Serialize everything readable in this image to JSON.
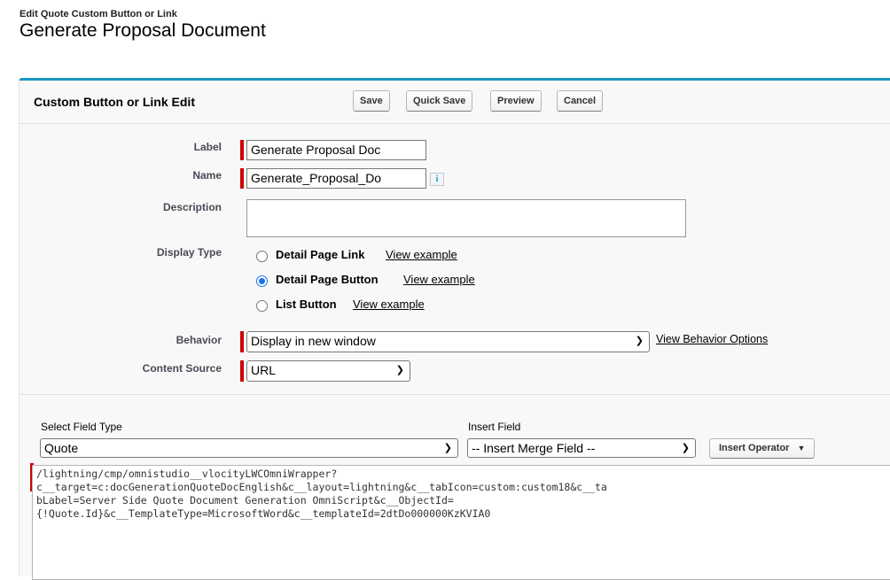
{
  "page": {
    "subtitle": "Edit Quote Custom Button or Link",
    "title": "Generate Proposal Document"
  },
  "panel": {
    "title": "Custom Button or Link Edit",
    "buttons": {
      "save": "Save",
      "quick_save": "Quick Save",
      "preview": "Preview",
      "cancel": "Cancel"
    }
  },
  "form": {
    "label": {
      "label": "Label",
      "value": "Generate Proposal Doc"
    },
    "name": {
      "label": "Name",
      "value": "Generate_Proposal_Do",
      "info_icon": "info-icon"
    },
    "description": {
      "label": "Description",
      "value": ""
    },
    "display_type": {
      "label": "Display Type",
      "options": [
        {
          "label": "Detail Page Link",
          "link": "View example",
          "checked": false
        },
        {
          "label": "Detail Page Button",
          "link": "View example",
          "checked": true
        },
        {
          "label": "List Button",
          "link": "View example",
          "checked": false
        }
      ]
    },
    "behavior": {
      "label": "Behavior",
      "value": "Display in new window",
      "link": "View Behavior Options"
    },
    "content_source": {
      "label": "Content Source",
      "value": "URL"
    }
  },
  "formula": {
    "select_field_type_label": "Select Field Type",
    "select_field_type_value": "Quote",
    "insert_field_label": "Insert Field",
    "insert_field_value": "-- Insert Merge Field --",
    "insert_operator": "Insert Operator",
    "operator_icon": "triangle-down-icon",
    "code": "/lightning/cmp/omnistudio__vlocityLWCOmniWrapper?\nc__target=c:docGenerationQuoteDocEnglish&c__layout=lightning&c__tabIcon=custom:custom18&c__ta\nbLabel=Server Side Quote Document Generation OmniScript&c__ObjectId=\n{!Quote.Id}&c__TemplateType=MicrosoftWord&c__templateId=2dtDo000000KzKVIA0"
  },
  "colors": {
    "accent": "#1797c0",
    "required": "#cc0000",
    "radio_selected": "#1a73e8"
  }
}
